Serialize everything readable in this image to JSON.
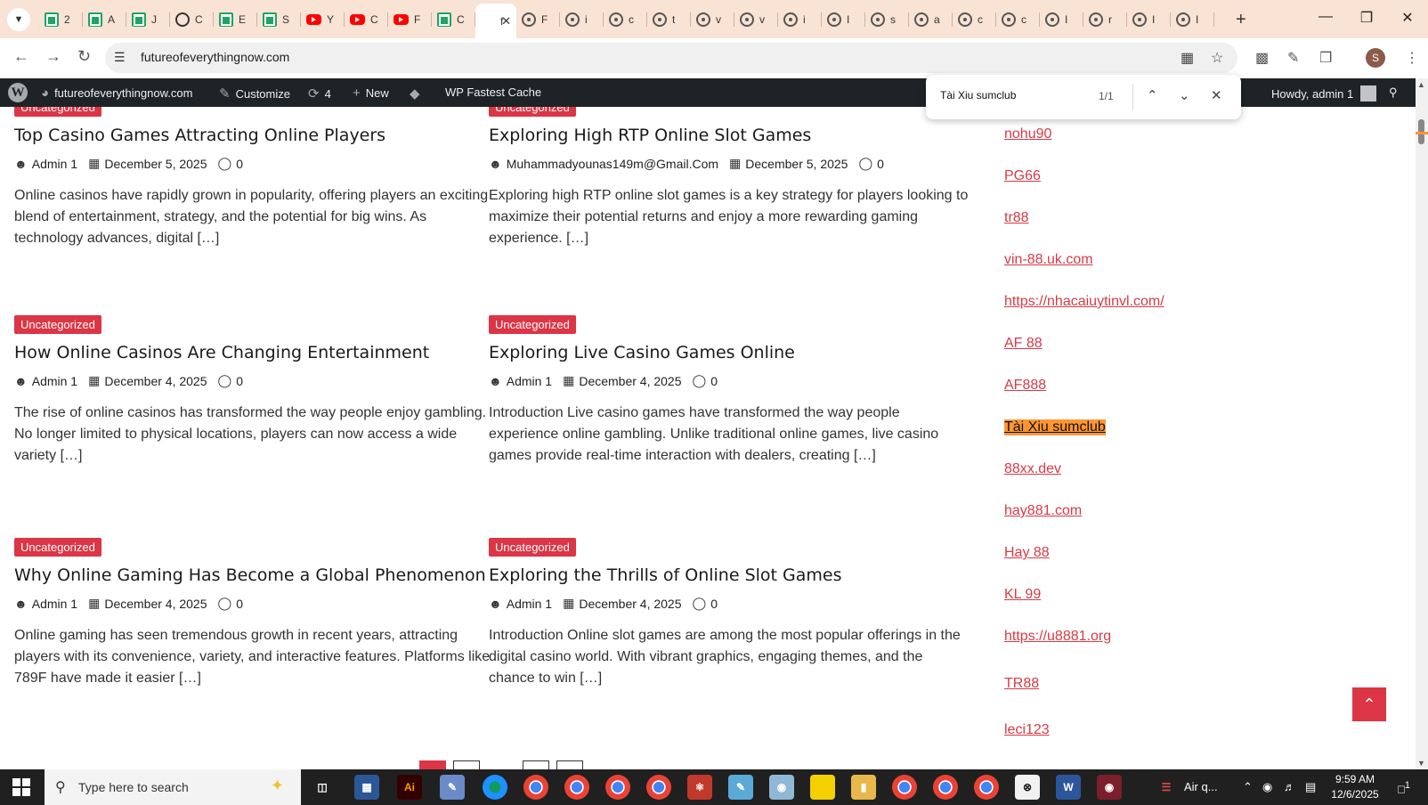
{
  "browser": {
    "tabs": [
      {
        "icon": "sheets-icon",
        "label": "2"
      },
      {
        "icon": "sheets-icon",
        "label": "A"
      },
      {
        "icon": "sheets-icon",
        "label": "J"
      },
      {
        "icon": "chatgpt-icon",
        "label": "C"
      },
      {
        "icon": "sheets-icon",
        "label": "E"
      },
      {
        "icon": "sheets-icon",
        "label": "S"
      },
      {
        "icon": "youtube-icon",
        "label": "Y"
      },
      {
        "icon": "youtube-icon",
        "label": "C"
      },
      {
        "icon": "youtube-icon",
        "label": "F"
      },
      {
        "icon": "sheets-icon",
        "label": "C"
      },
      {
        "icon": "page-icon",
        "label": "f",
        "active": true
      },
      {
        "icon": "globe-icon",
        "label": "F"
      },
      {
        "icon": "globe-icon",
        "label": "i"
      },
      {
        "icon": "globe-icon",
        "label": "c"
      },
      {
        "icon": "globe-icon",
        "label": "t"
      },
      {
        "icon": "globe-icon",
        "label": "v"
      },
      {
        "icon": "globe-icon",
        "label": "v"
      },
      {
        "icon": "globe-icon",
        "label": "i"
      },
      {
        "icon": "globe-icon",
        "label": "I"
      },
      {
        "icon": "globe-icon",
        "label": "s"
      },
      {
        "icon": "globe-icon",
        "label": "a"
      },
      {
        "icon": "globe-icon",
        "label": "c"
      },
      {
        "icon": "globe-icon",
        "label": "c"
      },
      {
        "icon": "globe-icon",
        "label": "I"
      },
      {
        "icon": "globe-icon",
        "label": "r"
      },
      {
        "icon": "globe-icon",
        "label": "I"
      },
      {
        "icon": "globe-icon",
        "label": "I"
      }
    ],
    "url": "futureofeverythingnow.com",
    "profile_initial": "S"
  },
  "wp_admin_bar": {
    "site_name": "futureofeverythingnow.com",
    "customize": "Customize",
    "updates_count": "4",
    "new": "New",
    "cache": "WP Fastest Cache",
    "howdy": "Howdy, admin 1"
  },
  "find_bar": {
    "query": "Tài Xiu sumclub",
    "count": "1/1"
  },
  "posts": [
    {
      "category": "Uncategorized",
      "title": "Top Casino Games Attracting Online Players",
      "author": "Admin 1",
      "date": "December 5, 2025",
      "comments": "0",
      "excerpt": "Online casinos have rapidly grown in popularity, offering players an exciting blend of entertainment, strategy, and the potential for big wins. As technology advances, digital […]"
    },
    {
      "category": "Uncategorized",
      "title": "Exploring High RTP Online Slot Games",
      "author": "Muhammadyounas149m@Gmail.Com",
      "date": "December 5, 2025",
      "comments": "0",
      "excerpt": "Exploring high RTP online slot games is a key strategy for players looking to maximize their potential returns and enjoy a more rewarding gaming experience. […]"
    },
    {
      "category": "Uncategorized",
      "title": "How Online Casinos Are Changing Entertainment",
      "author": "Admin 1",
      "date": "December 4, 2025",
      "comments": "0",
      "excerpt": "The rise of online casinos has transformed the way people enjoy gambling. No longer limited to physical locations, players can now access a wide variety […]"
    },
    {
      "category": "Uncategorized",
      "title": "Exploring Live Casino Games Online",
      "author": "Admin 1",
      "date": "December 4, 2025",
      "comments": "0",
      "excerpt": "Introduction Live casino games have transformed the way people experience online gambling. Unlike traditional online games, live casino games provide real-time interaction with dealers, creating […]"
    },
    {
      "category": "Uncategorized",
      "title": "Why Online Gaming Has Become a Global Phenomenon",
      "author": "Admin 1",
      "date": "December 4, 2025",
      "comments": "0",
      "excerpt": "Online gaming has seen tremendous growth in recent years, attracting players with its convenience, variety, and interactive features. Platforms like 789F have made it easier […]"
    },
    {
      "category": "Uncategorized",
      "title": "Exploring the Thrills of Online Slot Games",
      "author": "Admin 1",
      "date": "December 4, 2025",
      "comments": "0",
      "excerpt": "Introduction Online slot games are among the most popular offerings in the digital casino world. With vibrant graphics, engaging themes, and the chance to win […]"
    }
  ],
  "sidebar_links": [
    "nohu90",
    "PG66",
    "tr88",
    "vin-88.uk.com",
    "https://nhacaiuytinvl.com/",
    "AF 88",
    "AF888",
    "Tài Xiu sumclub",
    "88xx.dev",
    "hay881.com",
    "Hay 88",
    "KL 99",
    "https://u8881.org",
    "TR88",
    "leci123"
  ],
  "taskbar": {
    "search_placeholder": "Type here to search",
    "weather": "Air q...",
    "time": "9:59 AM",
    "date": "12/6/2025",
    "notifications": "1"
  },
  "colors": {
    "accent_red": "#dc3545",
    "link": "#d63b46",
    "find_highlight": "#ff9632",
    "tabstrip": "#f8e3d4",
    "wp_bar": "#1d2327"
  }
}
